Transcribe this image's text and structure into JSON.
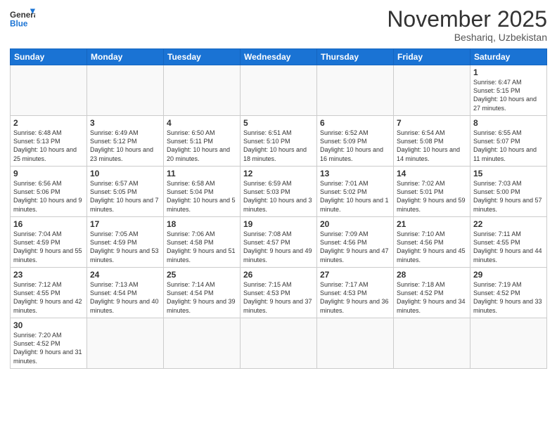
{
  "header": {
    "logo_general": "General",
    "logo_blue": "Blue",
    "month_title": "November 2025",
    "location": "Beshariq, Uzbekistan"
  },
  "weekdays": [
    "Sunday",
    "Monday",
    "Tuesday",
    "Wednesday",
    "Thursday",
    "Friday",
    "Saturday"
  ],
  "days": {
    "1": {
      "sunrise": "6:47 AM",
      "sunset": "5:15 PM",
      "daylight": "10 hours and 27 minutes."
    },
    "2": {
      "sunrise": "6:48 AM",
      "sunset": "5:13 PM",
      "daylight": "10 hours and 25 minutes."
    },
    "3": {
      "sunrise": "6:49 AM",
      "sunset": "5:12 PM",
      "daylight": "10 hours and 23 minutes."
    },
    "4": {
      "sunrise": "6:50 AM",
      "sunset": "5:11 PM",
      "daylight": "10 hours and 20 minutes."
    },
    "5": {
      "sunrise": "6:51 AM",
      "sunset": "5:10 PM",
      "daylight": "10 hours and 18 minutes."
    },
    "6": {
      "sunrise": "6:52 AM",
      "sunset": "5:09 PM",
      "daylight": "10 hours and 16 minutes."
    },
    "7": {
      "sunrise": "6:54 AM",
      "sunset": "5:08 PM",
      "daylight": "10 hours and 14 minutes."
    },
    "8": {
      "sunrise": "6:55 AM",
      "sunset": "5:07 PM",
      "daylight": "10 hours and 11 minutes."
    },
    "9": {
      "sunrise": "6:56 AM",
      "sunset": "5:06 PM",
      "daylight": "10 hours and 9 minutes."
    },
    "10": {
      "sunrise": "6:57 AM",
      "sunset": "5:05 PM",
      "daylight": "10 hours and 7 minutes."
    },
    "11": {
      "sunrise": "6:58 AM",
      "sunset": "5:04 PM",
      "daylight": "10 hours and 5 minutes."
    },
    "12": {
      "sunrise": "6:59 AM",
      "sunset": "5:03 PM",
      "daylight": "10 hours and 3 minutes."
    },
    "13": {
      "sunrise": "7:01 AM",
      "sunset": "5:02 PM",
      "daylight": "10 hours and 1 minute."
    },
    "14": {
      "sunrise": "7:02 AM",
      "sunset": "5:01 PM",
      "daylight": "9 hours and 59 minutes."
    },
    "15": {
      "sunrise": "7:03 AM",
      "sunset": "5:00 PM",
      "daylight": "9 hours and 57 minutes."
    },
    "16": {
      "sunrise": "7:04 AM",
      "sunset": "4:59 PM",
      "daylight": "9 hours and 55 minutes."
    },
    "17": {
      "sunrise": "7:05 AM",
      "sunset": "4:59 PM",
      "daylight": "9 hours and 53 minutes."
    },
    "18": {
      "sunrise": "7:06 AM",
      "sunset": "4:58 PM",
      "daylight": "9 hours and 51 minutes."
    },
    "19": {
      "sunrise": "7:08 AM",
      "sunset": "4:57 PM",
      "daylight": "9 hours and 49 minutes."
    },
    "20": {
      "sunrise": "7:09 AM",
      "sunset": "4:56 PM",
      "daylight": "9 hours and 47 minutes."
    },
    "21": {
      "sunrise": "7:10 AM",
      "sunset": "4:56 PM",
      "daylight": "9 hours and 45 minutes."
    },
    "22": {
      "sunrise": "7:11 AM",
      "sunset": "4:55 PM",
      "daylight": "9 hours and 44 minutes."
    },
    "23": {
      "sunrise": "7:12 AM",
      "sunset": "4:55 PM",
      "daylight": "9 hours and 42 minutes."
    },
    "24": {
      "sunrise": "7:13 AM",
      "sunset": "4:54 PM",
      "daylight": "9 hours and 40 minutes."
    },
    "25": {
      "sunrise": "7:14 AM",
      "sunset": "4:54 PM",
      "daylight": "9 hours and 39 minutes."
    },
    "26": {
      "sunrise": "7:15 AM",
      "sunset": "4:53 PM",
      "daylight": "9 hours and 37 minutes."
    },
    "27": {
      "sunrise": "7:17 AM",
      "sunset": "4:53 PM",
      "daylight": "9 hours and 36 minutes."
    },
    "28": {
      "sunrise": "7:18 AM",
      "sunset": "4:52 PM",
      "daylight": "9 hours and 34 minutes."
    },
    "29": {
      "sunrise": "7:19 AM",
      "sunset": "4:52 PM",
      "daylight": "9 hours and 33 minutes."
    },
    "30": {
      "sunrise": "7:20 AM",
      "sunset": "4:52 PM",
      "daylight": "9 hours and 31 minutes."
    }
  }
}
